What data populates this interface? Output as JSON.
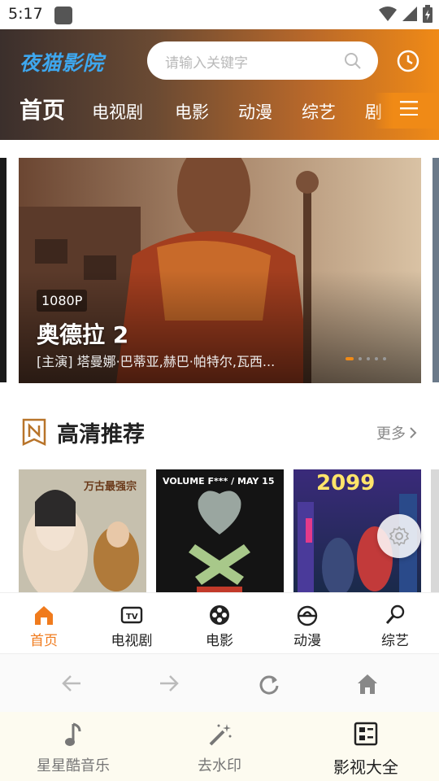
{
  "status": {
    "time": "5:17"
  },
  "header": {
    "logo": "夜猫影院",
    "search_placeholder": "请输入关键字",
    "tabs": [
      "首页",
      "电视剧",
      "电影",
      "动漫",
      "综艺",
      "剧"
    ]
  },
  "banner": {
    "quality": "1080P",
    "title": "奥德拉 2",
    "cast": "[主演] 塔曼娜·巴蒂亚,赫巴·帕特尔,瓦西..."
  },
  "section": {
    "title": "高清推荐",
    "more": "更多"
  },
  "posters": [
    {
      "text": "万古最强宗",
      "color": "#c7b7a0"
    },
    {
      "text": "VOLUME F*** / MAY 15",
      "color": "#141414"
    },
    {
      "text": "2099",
      "color": "#2b2b66"
    }
  ],
  "app_tabs": [
    {
      "label": "首页",
      "icon": "home-icon",
      "active": true
    },
    {
      "label": "电视剧",
      "icon": "tv-icon"
    },
    {
      "label": "电影",
      "icon": "film-reel-icon"
    },
    {
      "label": "动漫",
      "icon": "anime-icon"
    },
    {
      "label": "综艺",
      "icon": "microphone-icon"
    }
  ],
  "os_bar": [
    {
      "label": "星星酷音乐",
      "icon": "music-note-icon"
    },
    {
      "label": "去水印",
      "icon": "magic-wand-icon"
    },
    {
      "label": "影视大全",
      "icon": "grid-list-icon",
      "active": true
    }
  ],
  "colors": {
    "accent": "#f07b1d",
    "logo": "#3ea7ee"
  }
}
